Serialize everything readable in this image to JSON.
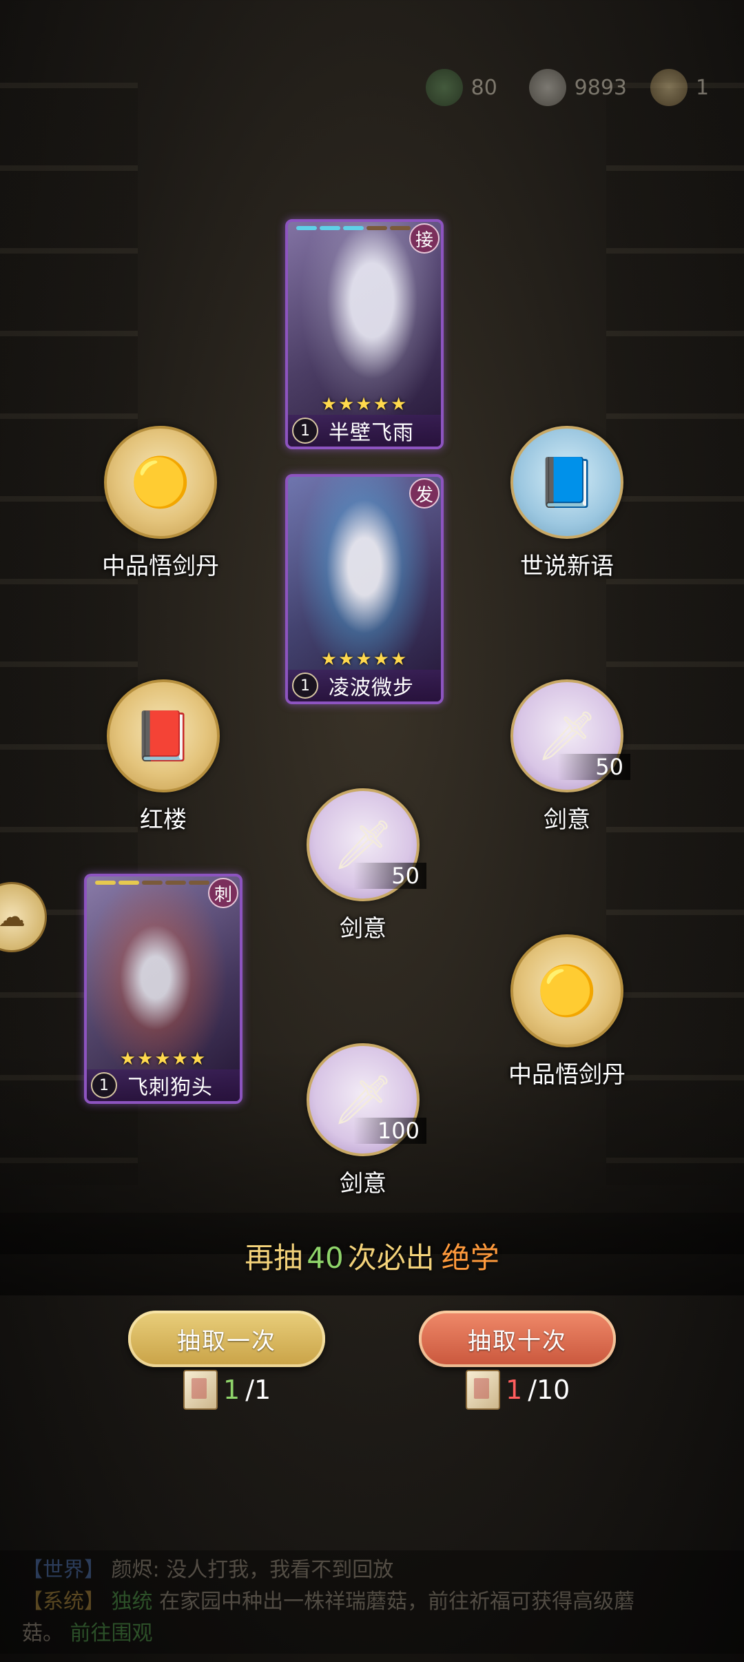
{
  "currency": [
    {
      "icon": "jade-icon",
      "value": "80"
    },
    {
      "icon": "bowl-icon",
      "value": "9893"
    },
    {
      "icon": "book-icon",
      "value": "1"
    }
  ],
  "cards": [
    {
      "role": "接",
      "stars": "★★★★★",
      "level": "1",
      "name": "半壁飞雨"
    },
    {
      "role": "发",
      "stars": "★★★★★",
      "level": "1",
      "name": "凌波微步"
    },
    {
      "role": "刺",
      "stars": "★★★★★",
      "level": "1",
      "name": "飞刺狗头"
    }
  ],
  "items": {
    "pill_left": {
      "label": "中品悟剑丹"
    },
    "book_right": {
      "label": "世说新语"
    },
    "book_redmansion": {
      "label": "红楼"
    },
    "sword_right": {
      "label": "剑意",
      "count": "50"
    },
    "sword_center": {
      "label": "剑意",
      "count": "50"
    },
    "pill_right": {
      "label": "中品悟剑丹"
    },
    "sword_bottom": {
      "label": "剑意",
      "count": "100"
    }
  },
  "pity": {
    "prefix": "再抽",
    "count": "40",
    "middle": "次必出",
    "reward": "绝学"
  },
  "buttons": {
    "draw_one": "抽取一次",
    "draw_ten": "抽取十次",
    "cost_one_have": "1",
    "cost_one_need": "/1",
    "cost_ten_have": "1",
    "cost_ten_need": "/10"
  },
  "chat": {
    "line1_tag": "【世界】",
    "line1_text": "颜烬: 没人打我，我看不到回放",
    "line2_tag": "【系统】",
    "line2_player": "独统",
    "line2_text": "在家园中种出一株祥瑞蘑菇，前往祈福可获得高级蘑",
    "line3_text": "菇。",
    "line3_link": "前往围观"
  }
}
